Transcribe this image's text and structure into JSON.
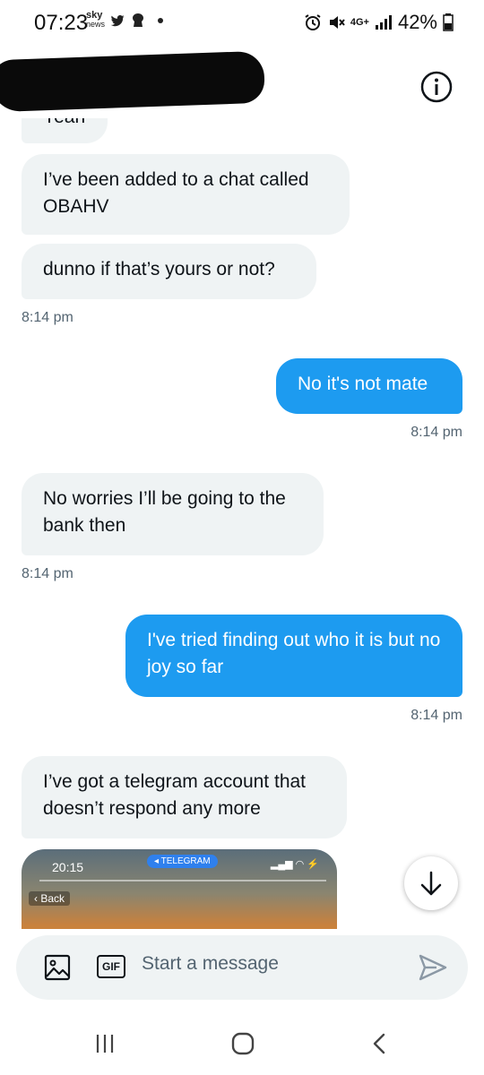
{
  "status_bar": {
    "time": "07:23",
    "sky_news_line1": "sky",
    "sky_news_line2": "news",
    "network": "4G+",
    "battery": "42%"
  },
  "messages": [
    {
      "type": "received",
      "text": "Yeah",
      "partial": true
    },
    {
      "type": "received",
      "text": "I’ve been added to a chat called OBAHV"
    },
    {
      "type": "received",
      "text": "dunno if that’s yours or not?",
      "time": "8:14 pm"
    },
    {
      "type": "sent",
      "text": "No it's not mate",
      "time": "8:14 pm"
    },
    {
      "type": "received",
      "text": "No worries I’ll be going to the bank then",
      "time": "8:14 pm"
    },
    {
      "type": "sent",
      "text": "I've tried finding out who it is but no joy so far",
      "time": "8:14 pm"
    },
    {
      "type": "received",
      "text": "I’ve got a telegram account that doesn’t respond any more"
    }
  ],
  "media_preview": {
    "time": "20:15",
    "app_pill": "TELEGRAM",
    "back_label": "Back"
  },
  "composer": {
    "gif_label": "GIF",
    "placeholder": "Start a message"
  },
  "colors": {
    "sent_bubble": "#1d9bf0",
    "received_bubble": "#eff3f4",
    "timestamp": "#536471",
    "accent": "#1d9bf0"
  },
  "icons": [
    "info-icon",
    "arrow-down-icon",
    "image-icon",
    "gif-icon",
    "send-icon",
    "recents-icon",
    "home-icon",
    "back-icon"
  ]
}
